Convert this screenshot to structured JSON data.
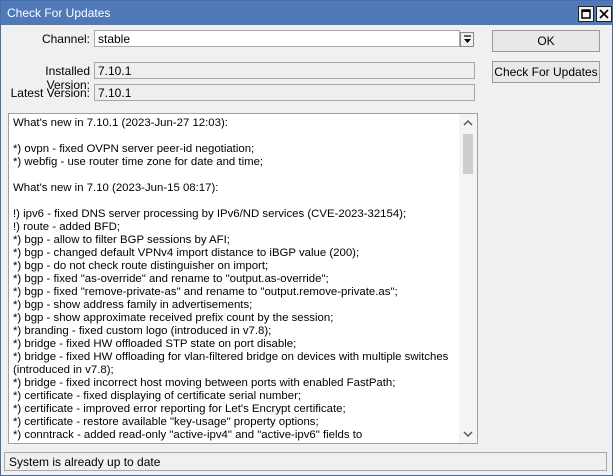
{
  "window": {
    "title": "Check For Updates"
  },
  "form": {
    "channel_label": "Channel:",
    "channel_value": "stable",
    "installed_label": "Installed Version:",
    "installed_value": "7.10.1",
    "latest_label": "Latest Version:",
    "latest_value": "7.10.1"
  },
  "buttons": {
    "ok": "OK",
    "check": "Check For Updates"
  },
  "notes": [
    "What's new in 7.10.1 (2023-Jun-27 12:03):",
    "",
    "*) ovpn - fixed OVPN server peer-id negotiation;",
    "*) webfig - use router time zone for date and time;",
    "",
    "What's new in 7.10 (2023-Jun-15 08:17):",
    "",
    "!) ipv6 - fixed DNS server processing by IPv6/ND services (CVE-2023-32154);",
    "!) route - added BFD;",
    "*) bgp - allow to filter BGP sessions by AFI;",
    "*) bgp - changed default VPNv4 import distance to iBGP value (200);",
    "*) bgp - do not check route distinguisher on import;",
    "*) bgp - fixed \"as-override\" and rename to \"output.as-override\";",
    "*) bgp - fixed \"remove-private-as\" and rename to \"output.remove-private.as\";",
    "*) bgp - show address family in advertisements;",
    "*) bgp - show approximate received prefix count by the session;",
    "*) branding - fixed custom logo (introduced in v7.8);",
    "*) bridge - fixed HW offloaded STP state on port disable;",
    "*) bridge - fixed HW offloading for vlan-filtered bridge on devices with multiple switches",
    "(introduced in v7.8);",
    "*) bridge - fixed incorrect host moving between ports with enabled FastPath;",
    "*) certificate - fixed displaying of certificate serial number;",
    "*) certificate - improved error reporting for Let's Encrypt certificate;",
    "*) certificate - restore available \"key-usage\" property options;",
    "*) conntrack - added read-only \"active-ipv4\" and \"active-ipv6\" fields to"
  ],
  "status": {
    "text": "System is already up to date"
  }
}
